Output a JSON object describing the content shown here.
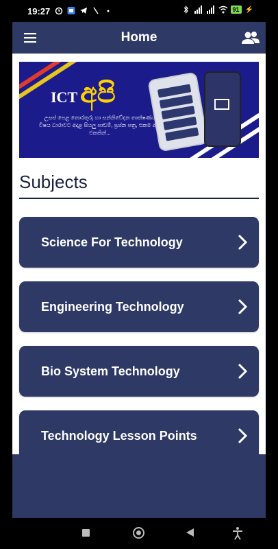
{
  "status_bar": {
    "time": "19:27",
    "battery": "91"
  },
  "header": {
    "title": "Home"
  },
  "banner": {
    "logo_prefix": "ICT",
    "logo_main": "අපි",
    "tagline": "උසස් පෙළ තොරතුරු හා සන්නිවේදන තාක්ෂණය විෂය ධාරාවට අදාළ සියලු පාඩම්, ප්‍රශ්න පත්‍ර, එකම ඇප් එකකින්..."
  },
  "section": {
    "title": "Subjects"
  },
  "subjects": [
    {
      "label": "Science For Technology"
    },
    {
      "label": "Engineering Technology"
    },
    {
      "label": "Bio System Technology"
    },
    {
      "label": "Technology Lesson Points"
    }
  ],
  "colors": {
    "primary": "#2e3966",
    "banner_bg": "#1c1b8c",
    "accent_yellow": "#ffd100"
  },
  "icons": [
    "menu-icon",
    "people-icon",
    "chevron-right-icon",
    "square-nav-icon",
    "home-nav-icon",
    "back-nav-icon",
    "accessibility-icon"
  ]
}
